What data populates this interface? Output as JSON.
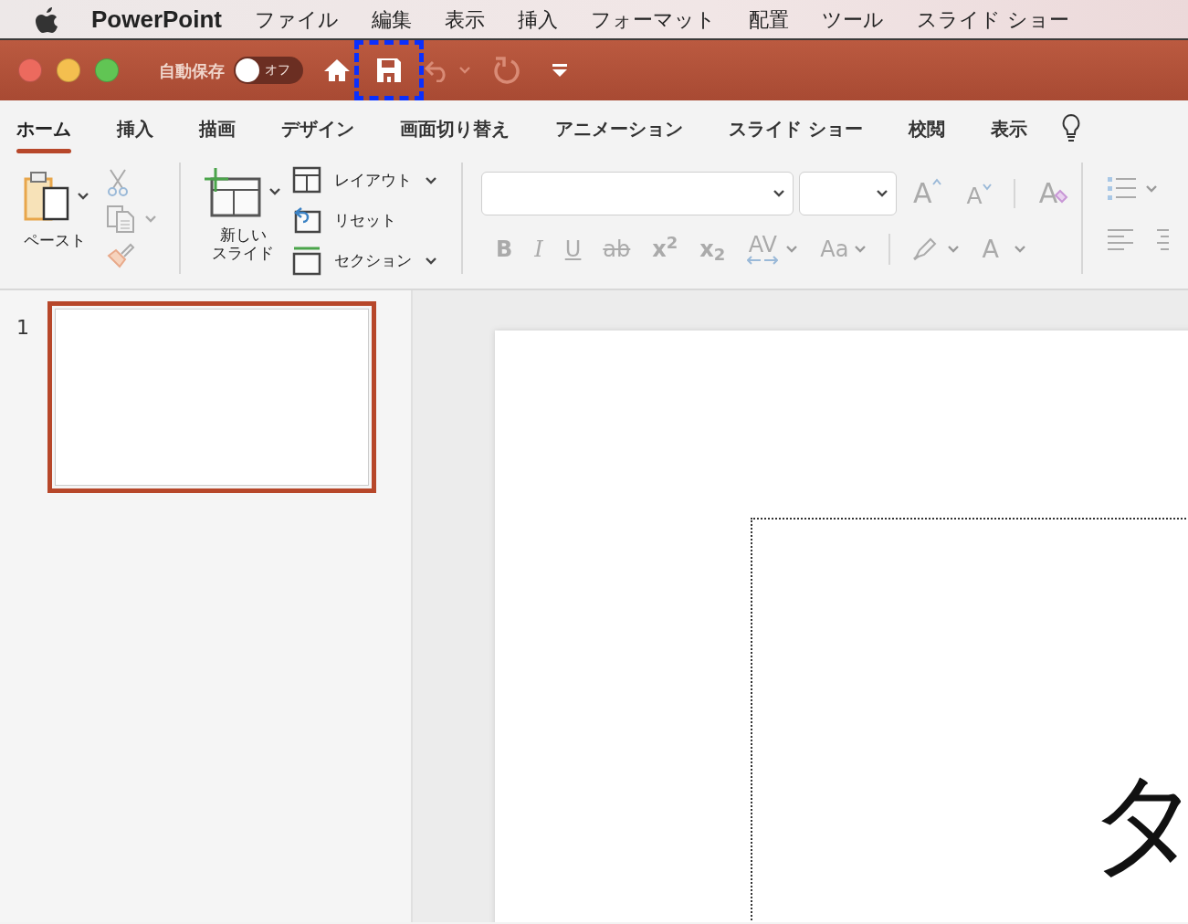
{
  "menubar": {
    "app": "PowerPoint",
    "menus": [
      "ファイル",
      "編集",
      "表示",
      "挿入",
      "フォーマット",
      "配置",
      "ツール",
      "スライド ショー"
    ]
  },
  "titlebar": {
    "autosave_label": "自動保存",
    "autosave": {
      "on": false,
      "text": "オフ"
    },
    "save_highlighted": true,
    "undo_disabled": true,
    "redo_disabled": true
  },
  "tabs": [
    {
      "label": "ホーム",
      "selected": true
    },
    {
      "label": "挿入",
      "selected": false
    },
    {
      "label": "描画",
      "selected": false
    },
    {
      "label": "デザイン",
      "selected": false
    },
    {
      "label": "画面切り替え",
      "selected": false
    },
    {
      "label": "アニメーション",
      "selected": false
    },
    {
      "label": "スライド ショー",
      "selected": false
    },
    {
      "label": "校閲",
      "selected": false
    },
    {
      "label": "表示",
      "selected": false
    }
  ],
  "ribbon": {
    "paste": "ペースト",
    "new_slide": [
      "新しい",
      "スライド"
    ],
    "slide_commands": [
      {
        "kind": "layout",
        "label": "レイアウト",
        "dropdown": true
      },
      {
        "kind": "reset",
        "label": "リセット",
        "dropdown": false
      },
      {
        "kind": "section",
        "label": "セクション",
        "dropdown": true
      }
    ],
    "format_buttons": [
      {
        "kind": "bold",
        "label": "B",
        "disabled": true
      },
      {
        "kind": "italic",
        "label": "I",
        "disabled": true
      },
      {
        "kind": "underline",
        "label": "U",
        "disabled": true
      },
      {
        "kind": "strike",
        "label": "ab",
        "disabled": true
      },
      {
        "kind": "super",
        "label": "x$^{2}$",
        "disabled": true
      },
      {
        "kind": "sub",
        "label": "x$_{2}$",
        "disabled": true
      },
      {
        "kind": "spacing",
        "label": "AV",
        "disabled": true
      },
      {
        "kind": "case",
        "label": "Aa",
        "disabled": true
      }
    ],
    "font_color_label": "A",
    "grow_label": "A",
    "shrink_label": "A",
    "clear_label": "A"
  },
  "slides": [
    {
      "number": "1",
      "selected": true
    }
  ],
  "slide": {
    "text": "タ"
  }
}
